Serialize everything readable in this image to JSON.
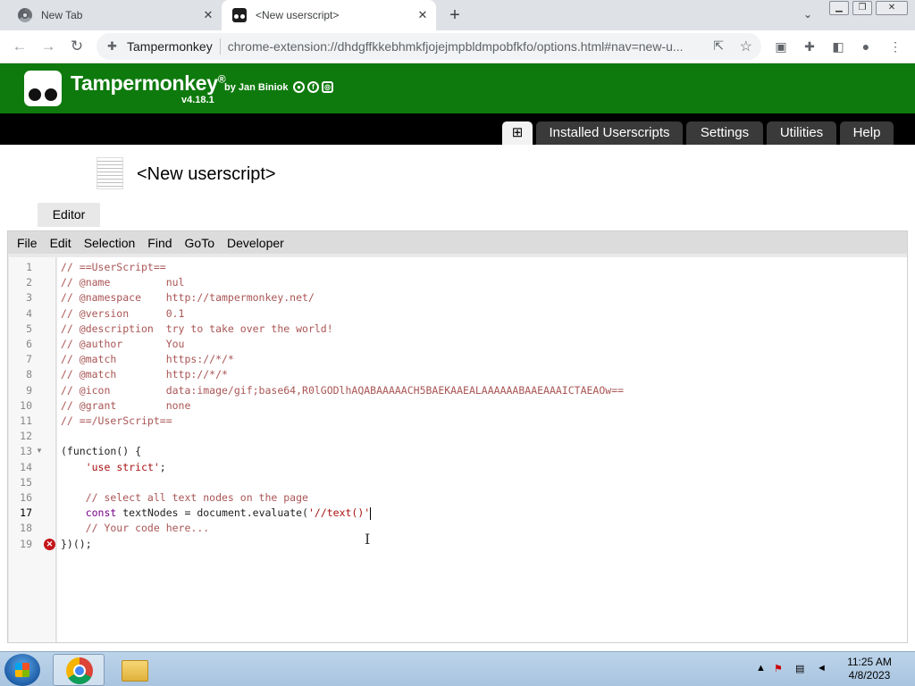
{
  "browser": {
    "tabs": [
      {
        "title": "New Tab",
        "close": "✕"
      },
      {
        "title": "<New userscript>",
        "close": "✕"
      }
    ],
    "new_tab": "+",
    "tab_search": "⌄",
    "window_controls": {
      "minimize": "▁",
      "restore": "❐",
      "close": "✕"
    },
    "nav": {
      "back": "←",
      "forward": "→",
      "reload": "↻"
    },
    "omnibox": {
      "site": "Tampermonkey",
      "url": "chrome-extension://dhdgffkkebhmkfjojejmpbldmpobfkfo/options.html#nav=new-u..."
    }
  },
  "tm": {
    "title": "Tampermonkey",
    "registered": "®",
    "by": "by Jan Biniok",
    "version": "v4.18.1",
    "nav_tabs": [
      "Installed Userscripts",
      "Settings",
      "Utilities",
      "Help"
    ],
    "add_tab": "⊞"
  },
  "page": {
    "title": "<New userscript>",
    "editor_tab": "Editor",
    "menu": [
      "File",
      "Edit",
      "Selection",
      "Find",
      "GoTo",
      "Developer"
    ]
  },
  "editor": {
    "active_line": 17,
    "error_line": 19,
    "fold_line": 13,
    "lines": [
      "// ==UserScript==",
      "// @name         nul",
      "// @namespace    http://tampermonkey.net/",
      "// @version      0.1",
      "// @description  try to take over the world!",
      "// @author       You",
      "// @match        https://*/*",
      "// @match        http://*/*",
      "// @icon         data:image/gif;base64,R0lGODlhAQABAAAAACH5BAEKAAEALAAAAAABAAEAAAICTAEAOw==",
      "// @grant        none",
      "// ==/UserScript==",
      "",
      "(function() {",
      "    'use strict';",
      "",
      "    // select all text nodes on the page",
      "    const textNodes = document.evaluate('//text()'",
      "    // Your code here...",
      "})();"
    ]
  },
  "taskbar": {
    "time": "11:25 AM",
    "date": "4/8/2023"
  }
}
